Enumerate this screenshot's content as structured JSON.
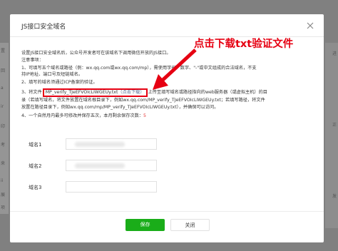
{
  "background": {
    "left_fragments": [
      "置",
      "回",
      "a",
      "ir",
      "印",
      "考",
      "来",
      "ii",
      "展",
      "项"
    ],
    "right_fragments": [
      "进",
      "正",
      "发"
    ]
  },
  "dialog": {
    "title": "JS接口安全域名",
    "intro": "设置JS接口安全域名后，公众号开发者可在该域名下调用微信开放的JS接口。",
    "notes_label": "注意事项：",
    "note1_line1": "1、可填写五个域名或路径（例：wx.qq.com或wx.qq.com/mp），需使用字母、数字、\"-\"或中文组成的合法域名，不支",
    "note1_line2": "持IP地址、端口号及短链域名。",
    "note2": "2、填写的域名须通过ICP备案的验证。",
    "note3_prefix": "3、将文件",
    "note3_file": "MP_verify_TJeEFVOIcLIWGEUy.txt",
    "note3_download": "（点击下载）",
    "note3_suffix": "上传至填写域名或路径指向的web服务器（或虚拟主机）的目",
    "note3_line2": "录（若填写域名，将文件放置在域名根目录下，例如wx.qq.com/MP_verify_TJeEFVOIcLIWGEUy.txt；若填写路径，将文件",
    "note3_line3": "放置在路径目录下，例如wx.qq.com/mp/MP_verify_TJeEFVOIcLIWGEUy.txt），并确保可以访问。",
    "note4_prefix": "4、一个自然月内最多可修改并保存五次，本月剩余保存次数：",
    "note4_count": "5",
    "annotation": "点击下载txt验证文件",
    "fields": [
      {
        "label": "域名1"
      },
      {
        "label": "域名2"
      },
      {
        "label": "域名3"
      }
    ],
    "save_label": "保存",
    "close_label": "关闭"
  }
}
